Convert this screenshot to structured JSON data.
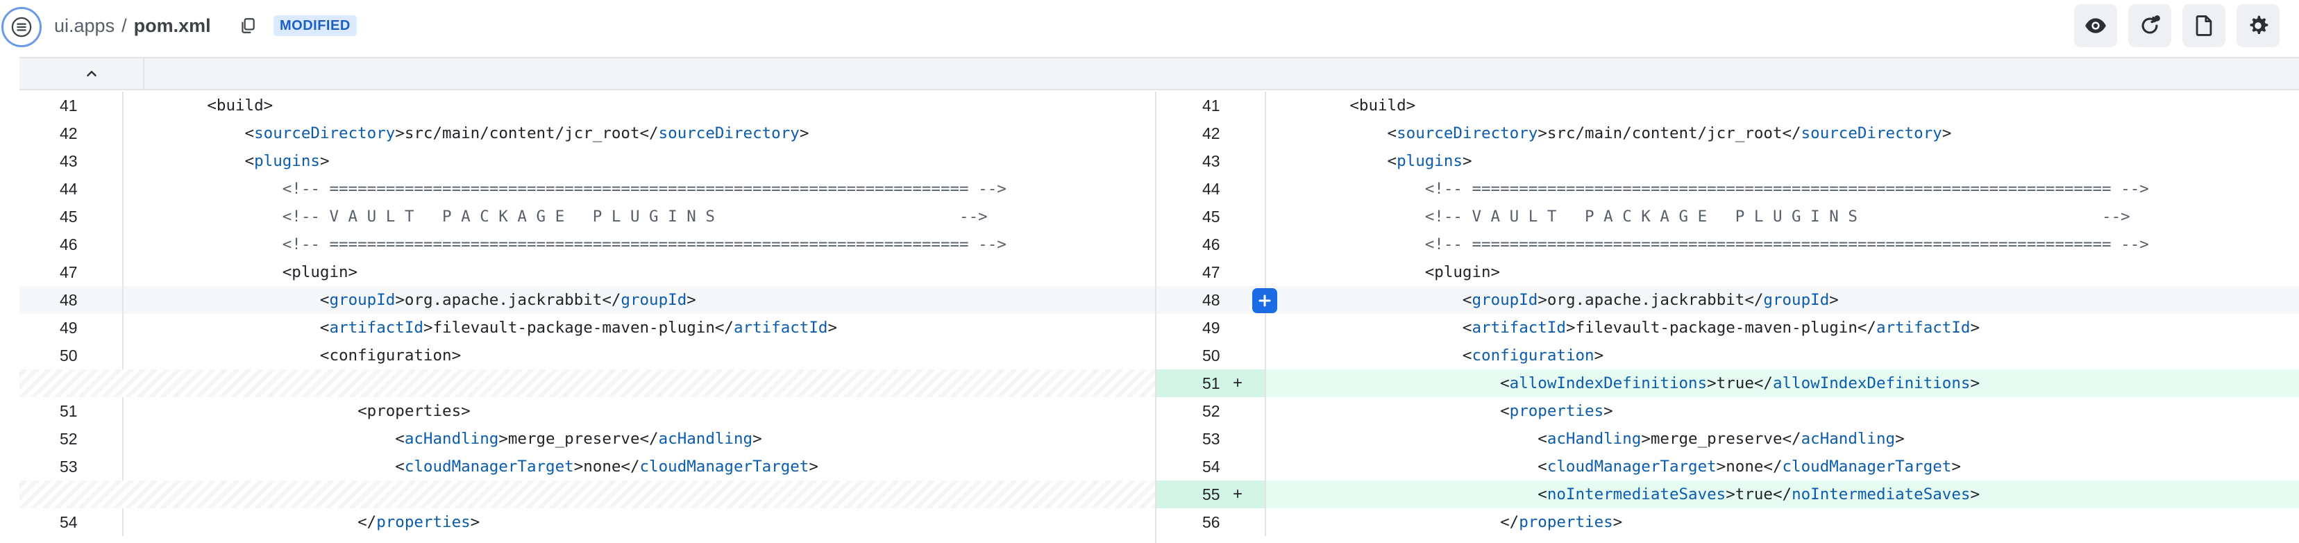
{
  "header": {
    "repo": "ui.apps",
    "separator": "/",
    "file": "pom.xml",
    "status_badge": "MODIFIED",
    "toolbar_icons": [
      "eye-icon",
      "refresh-comment-icon",
      "file-icon",
      "gear-icon"
    ]
  },
  "colors": {
    "accent": "#1b6ce4",
    "added_bg": "#e6fbf2",
    "tag": "#0b5cad"
  },
  "left": {
    "rows": [
      {
        "ln": "41",
        "type": "normal",
        "code": [
          [
            "        ",
            ""
          ],
          [
            "<build>",
            "x"
          ]
        ]
      },
      {
        "ln": "42",
        "type": "normal",
        "code": [
          [
            "            <",
            "x"
          ],
          [
            "sourceDirectory",
            "t"
          ],
          [
            ">src/main/content/jcr_root</",
            "x"
          ],
          [
            "sourceDirectory",
            "t"
          ],
          [
            ">",
            "x"
          ]
        ]
      },
      {
        "ln": "43",
        "type": "normal",
        "code": [
          [
            "            <",
            "x"
          ],
          [
            "plugins",
            "t"
          ],
          [
            ">",
            "x"
          ]
        ]
      },
      {
        "ln": "44",
        "type": "normal",
        "code": [
          [
            "                <!-- ==================================================================== -->",
            "c"
          ]
        ]
      },
      {
        "ln": "45",
        "type": "normal",
        "code": [
          [
            "                <!-- V A U L T   P A C K A G E   P L U G I N S                          -->",
            "c"
          ]
        ]
      },
      {
        "ln": "46",
        "type": "normal",
        "code": [
          [
            "                <!-- ==================================================================== -->",
            "c"
          ]
        ]
      },
      {
        "ln": "47",
        "type": "normal",
        "code": [
          [
            "                <plugin>",
            "x"
          ]
        ]
      },
      {
        "ln": "48",
        "type": "hl",
        "code": [
          [
            "                    <",
            "x"
          ],
          [
            "groupId",
            "t"
          ],
          [
            ">org.apache.jackrabbit</",
            "x"
          ],
          [
            "groupId",
            "t"
          ],
          [
            ">",
            "x"
          ]
        ]
      },
      {
        "ln": "49",
        "type": "normal",
        "code": [
          [
            "                    <",
            "x"
          ],
          [
            "artifactId",
            "t"
          ],
          [
            ">filevault-package-maven-plugin</",
            "x"
          ],
          [
            "artifactId",
            "t"
          ],
          [
            ">",
            "x"
          ]
        ]
      },
      {
        "ln": "50",
        "type": "normal",
        "code": [
          [
            "                    <configuration>",
            "x"
          ]
        ]
      },
      {
        "ln": "",
        "type": "empty",
        "code": []
      },
      {
        "ln": "51",
        "type": "normal",
        "code": [
          [
            "                        <properties>",
            "x"
          ]
        ]
      },
      {
        "ln": "52",
        "type": "normal",
        "code": [
          [
            "                            <",
            "x"
          ],
          [
            "acHandling",
            "t"
          ],
          [
            ">merge_preserve</",
            "x"
          ],
          [
            "acHandling",
            "t"
          ],
          [
            ">",
            "x"
          ]
        ]
      },
      {
        "ln": "53",
        "type": "normal",
        "code": [
          [
            "                            <",
            "x"
          ],
          [
            "cloudManagerTarget",
            "t"
          ],
          [
            ">none</",
            "x"
          ],
          [
            "cloudManagerTarget",
            "t"
          ],
          [
            ">",
            "x"
          ]
        ]
      },
      {
        "ln": "",
        "type": "empty",
        "code": []
      },
      {
        "ln": "54",
        "type": "normal",
        "code": [
          [
            "                        </",
            "x"
          ],
          [
            "properties",
            "t"
          ],
          [
            ">",
            "x"
          ]
        ]
      }
    ]
  },
  "right": {
    "rows": [
      {
        "ln": "41",
        "type": "normal",
        "code": [
          [
            "        <build>",
            "x"
          ]
        ]
      },
      {
        "ln": "42",
        "type": "normal",
        "code": [
          [
            "            <",
            "x"
          ],
          [
            "sourceDirectory",
            "t"
          ],
          [
            ">src/main/content/jcr_root</",
            "x"
          ],
          [
            "sourceDirectory",
            "t"
          ],
          [
            ">",
            "x"
          ]
        ]
      },
      {
        "ln": "43",
        "type": "normal",
        "code": [
          [
            "            <",
            "x"
          ],
          [
            "plugins",
            "t"
          ],
          [
            ">",
            "x"
          ]
        ]
      },
      {
        "ln": "44",
        "type": "normal",
        "code": [
          [
            "                <!-- ==================================================================== -->",
            "c"
          ]
        ]
      },
      {
        "ln": "45",
        "type": "normal",
        "code": [
          [
            "                <!-- V A U L T   P A C K A G E   P L U G I N S                          -->",
            "c"
          ]
        ]
      },
      {
        "ln": "46",
        "type": "normal",
        "code": [
          [
            "                <!-- ==================================================================== -->",
            "c"
          ]
        ]
      },
      {
        "ln": "47",
        "type": "normal",
        "code": [
          [
            "                <plugin>",
            "x"
          ]
        ]
      },
      {
        "ln": "48",
        "type": "hl",
        "plus": true,
        "code": [
          [
            "                    <",
            "x"
          ],
          [
            "groupId",
            "t"
          ],
          [
            ">org.apache.jackrabbit</",
            "x"
          ],
          [
            "groupId",
            "t"
          ],
          [
            ">",
            "x"
          ]
        ]
      },
      {
        "ln": "49",
        "type": "normal",
        "code": [
          [
            "                    <",
            "x"
          ],
          [
            "artifactId",
            "t"
          ],
          [
            ">filevault-package-maven-plugin</",
            "x"
          ],
          [
            "artifactId",
            "t"
          ],
          [
            ">",
            "x"
          ]
        ]
      },
      {
        "ln": "50",
        "type": "normal",
        "code": [
          [
            "                    <",
            "x"
          ],
          [
            "configuration",
            "t"
          ],
          [
            ">",
            "x"
          ]
        ]
      },
      {
        "ln": "51",
        "type": "added",
        "mark": "+",
        "code": [
          [
            "                        <",
            "x"
          ],
          [
            "allowIndexDefinitions",
            "t"
          ],
          [
            ">true</",
            "x"
          ],
          [
            "allowIndexDefinitions",
            "t"
          ],
          [
            ">",
            "x"
          ]
        ]
      },
      {
        "ln": "52",
        "type": "normal",
        "code": [
          [
            "                        <",
            "x"
          ],
          [
            "properties",
            "t"
          ],
          [
            ">",
            "x"
          ]
        ]
      },
      {
        "ln": "53",
        "type": "normal",
        "code": [
          [
            "                            <",
            "x"
          ],
          [
            "acHandling",
            "t"
          ],
          [
            ">merge_preserve</",
            "x"
          ],
          [
            "acHandling",
            "t"
          ],
          [
            ">",
            "x"
          ]
        ]
      },
      {
        "ln": "54",
        "type": "normal",
        "code": [
          [
            "                            <",
            "x"
          ],
          [
            "cloudManagerTarget",
            "t"
          ],
          [
            ">none</",
            "x"
          ],
          [
            "cloudManagerTarget",
            "t"
          ],
          [
            ">",
            "x"
          ]
        ]
      },
      {
        "ln": "55",
        "type": "added",
        "mark": "+",
        "code": [
          [
            "                            <",
            "x"
          ],
          [
            "noIntermediateSaves",
            "t"
          ],
          [
            ">true</",
            "x"
          ],
          [
            "noIntermediateSaves",
            "t"
          ],
          [
            ">",
            "x"
          ]
        ]
      },
      {
        "ln": "56",
        "type": "normal",
        "code": [
          [
            "                        </",
            "x"
          ],
          [
            "properties",
            "t"
          ],
          [
            ">",
            "x"
          ]
        ]
      }
    ]
  }
}
